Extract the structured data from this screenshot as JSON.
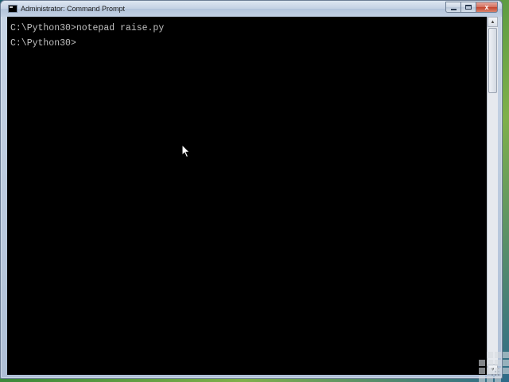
{
  "window": {
    "title": "Administrator: Command Prompt",
    "icon": "console-icon"
  },
  "caption_buttons": {
    "minimize_icon": "minimize-icon",
    "maximize_icon": "maximize-icon",
    "close_label": "x"
  },
  "console": {
    "lines": [
      "C:\\Python30>notepad raise.py",
      "C:\\Python30>"
    ],
    "background": "#000000",
    "foreground": "#c0c0c0"
  },
  "scrollbar": {
    "up_icon": "▲",
    "down_icon": "▼"
  }
}
